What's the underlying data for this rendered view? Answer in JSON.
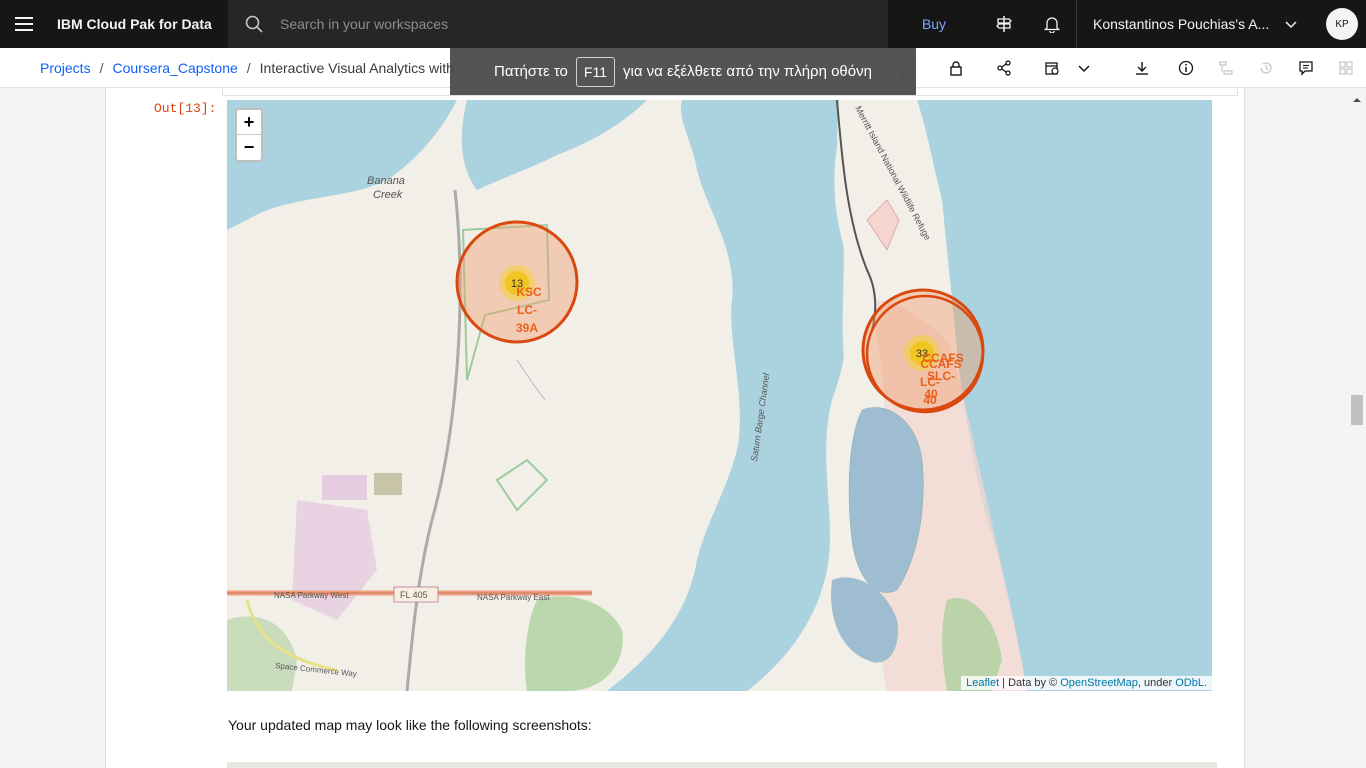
{
  "app": {
    "brand": "IBM Cloud Pak for Data",
    "search_placeholder": "Search in your workspaces",
    "buy_label": "Buy",
    "account_name": "Konstantinos Pouchias's A...",
    "avatar_initials": "KP",
    "accent": "#0f62fe"
  },
  "breadcrumbs": [
    {
      "label": "Projects"
    },
    {
      "label": "Coursera_Capstone"
    },
    {
      "label": "Interactive Visual Analytics with ..."
    }
  ],
  "fullscreen_toast": {
    "before": "Πατήστε το",
    "key": "F11",
    "after": "για να εξέλθετε από την πλήρη οθόνη"
  },
  "cell": {
    "out_label": "Out[13]:",
    "paragraph": "Your updated map may look like the following screenshots:"
  },
  "map": {
    "zoom_in": "+",
    "zoom_out": "−",
    "attribution": {
      "leaflet": "Leaflet",
      "data_by": " | Data by © ",
      "osm": "OpenStreetMap",
      "under": ", under ",
      "license": "ODbL."
    },
    "clusters": [
      {
        "count": "13",
        "site_lines": [
          "KSC",
          "LC-",
          "39A"
        ]
      },
      {
        "count": "33",
        "site_lines": [
          "CCAFS",
          "SLC-",
          "40"
        ],
        "site_lines_2": [
          "CCAFS",
          "LC-",
          "40"
        ]
      }
    ],
    "place_labels": {
      "banana_1": "Banana",
      "banana_2": "Creek",
      "channel": "Saturn Barge Channel",
      "refuge": "Merritt Island National Wildlife Refuge",
      "road_west": "NASA Parkway West",
      "road_shield": "FL 405",
      "road_east": "NASA Parkway East",
      "space_commerce": "Space Commerce Way"
    },
    "colors": {
      "water": "#aad3df",
      "land": "#f2efe9",
      "circle": "#d9480f",
      "circle_fill": "#f0a070"
    }
  }
}
